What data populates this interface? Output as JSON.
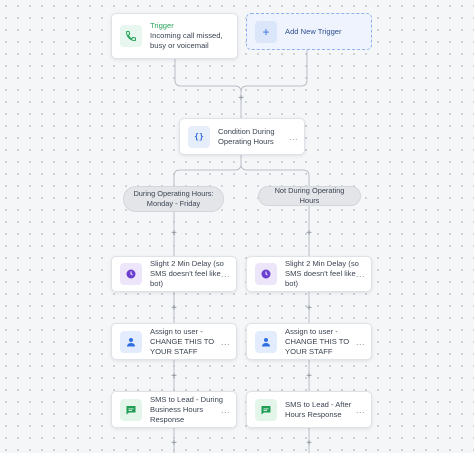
{
  "trigger": {
    "title": "Trigger",
    "description": "Incoming call missed, busy or voicemail",
    "icon": "phone-icon",
    "title_color": "#27a35a"
  },
  "add_trigger": {
    "label": "Add New Trigger",
    "icon": "plus-icon"
  },
  "condition": {
    "label": "Condition During Operating Hours",
    "icon": "code-braces-icon",
    "more": "..."
  },
  "branches": [
    {
      "label": "During Operating Hours: Monday - Friday",
      "steps": [
        {
          "label": "Slight 2 Min Delay (so SMS doesn't feel like bot)",
          "icon": "clock-icon",
          "more": "..."
        },
        {
          "label": "Assign to user - CHANGE THIS TO YOUR STAFF",
          "icon": "user-icon",
          "more": "..."
        },
        {
          "label": "SMS to Lead - During Business Hours Response",
          "icon": "sms-icon",
          "more": "..."
        }
      ]
    },
    {
      "label": "Not During Operating Hours",
      "steps": [
        {
          "label": "Slight 2 Min Delay (so SMS doesn't feel like bot)",
          "icon": "clock-icon",
          "more": "..."
        },
        {
          "label": "Assign to user - CHANGE THIS TO YOUR STAFF",
          "icon": "user-icon",
          "more": "..."
        },
        {
          "label": "SMS to Lead - After Hours Response",
          "icon": "sms-icon",
          "more": "..."
        }
      ]
    }
  ],
  "add_step_symbol": "+",
  "colors": {
    "accent_blue": "#2f6fe0",
    "delay_purple": "#6b3fd0",
    "sms_green": "#1f9d55",
    "trigger_green": "#27a35a"
  }
}
